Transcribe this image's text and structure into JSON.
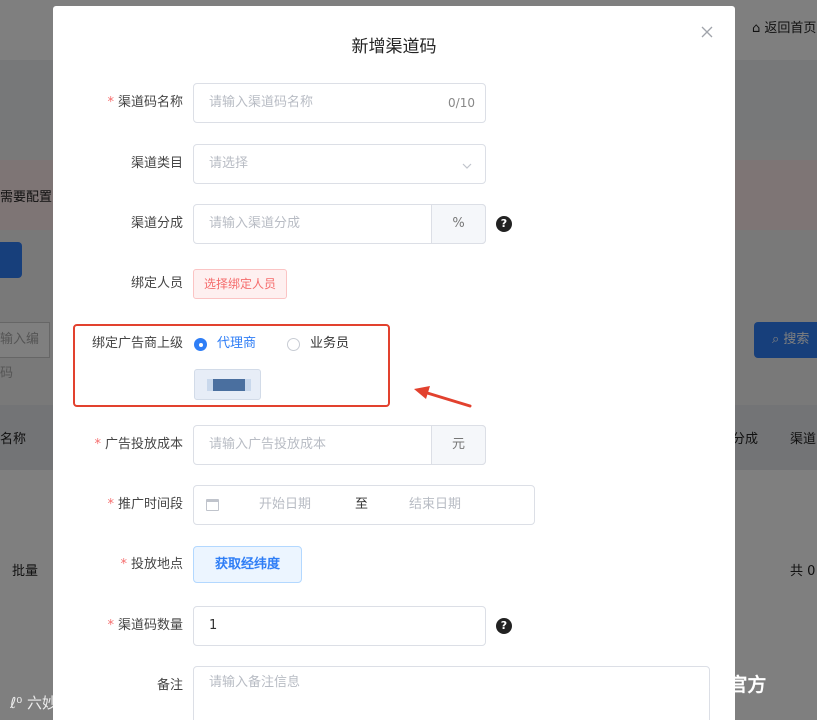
{
  "dialog": {
    "title": "新增渠道码",
    "close_icon": "close-icon"
  },
  "form": {
    "name": {
      "label": "渠道码名称",
      "placeholder": "请输入渠道码名称",
      "counter": "0/10",
      "required": true
    },
    "category": {
      "label": "渠道类目",
      "placeholder": "请选择",
      "required": false
    },
    "share": {
      "label": "渠道分成",
      "placeholder": "请输入渠道分成",
      "suffix": "%",
      "help_icon": "question-icon"
    },
    "staff": {
      "label": "绑定人员",
      "button": "选择绑定人员"
    },
    "superior": {
      "label": "绑定广告商上级",
      "options": [
        "代理商",
        "业务员"
      ],
      "selected": "代理商"
    },
    "cost": {
      "label": "广告投放成本",
      "placeholder": "请输入广告投放成本",
      "suffix": "元",
      "required": true
    },
    "period": {
      "label": "推广时间段",
      "start_placeholder": "开始日期",
      "separator": "至",
      "end_placeholder": "结束日期",
      "required": true
    },
    "location": {
      "label": "投放地点",
      "button": "获取经纬度",
      "required": true
    },
    "quantity": {
      "label": "渠道码数量",
      "value": "1",
      "required": true
    },
    "remark": {
      "label": "备注",
      "placeholder": "请输入备注信息"
    }
  },
  "background": {
    "home_link": "返回首页",
    "alert_text": "需要配置",
    "search_placeholder": "输入编码",
    "search_button": "搜索",
    "col_name": "名称",
    "col_share": "分成",
    "col_channel": "渠道",
    "batch": "批量",
    "total": "共 0"
  },
  "watermarks": {
    "left": "六妙跨境",
    "right": "龙兵官方"
  },
  "colors": {
    "primary": "#2f7ef6",
    "danger": "#f56c6c",
    "annotation": "#e2412e"
  }
}
